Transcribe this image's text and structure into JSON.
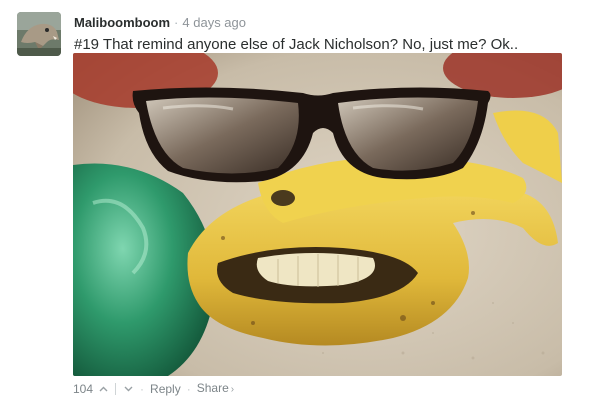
{
  "comment": {
    "username": "Maliboomboom",
    "separator": "·",
    "timestamp": "4 days ago",
    "text": "#19 That remind anyone else of Jack Nicholson? No, just me? Ok..",
    "image_description_icon": "photo"
  },
  "footer": {
    "vote_count": "104",
    "upvote_icon": "chevron-up-icon",
    "downvote_icon": "chevron-down-icon",
    "dot": "·",
    "reply_label": "Reply",
    "share_label": "Share",
    "share_chevron": "›"
  },
  "colors": {
    "username": "#2a2e2e",
    "meta": "#8e9499",
    "footer": "#7d8589"
  }
}
